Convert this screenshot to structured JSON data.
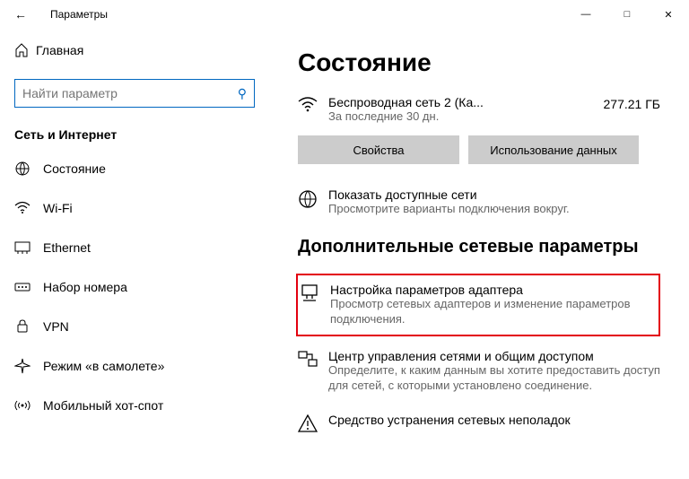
{
  "window": {
    "title": "Параметры"
  },
  "sidebar": {
    "home": "Главная",
    "search_placeholder": "Найти параметр",
    "group": "Сеть и Интернет",
    "items": [
      {
        "label": "Состояние"
      },
      {
        "label": "Wi-Fi"
      },
      {
        "label": "Ethernet"
      },
      {
        "label": "Набор номера"
      },
      {
        "label": "VPN"
      },
      {
        "label": "Режим «в самолете»"
      },
      {
        "label": "Мобильный хот-спот"
      }
    ]
  },
  "status": {
    "heading": "Состояние",
    "network_name": "Беспроводная сеть 2 (Ка...",
    "network_sub": "За последние 30 дн.",
    "data_amount": "277.21 ГБ",
    "btn_props": "Свойства",
    "btn_usage": "Использование данных",
    "show_title": "Показать доступные сети",
    "show_sub": "Просмотрите варианты подключения вокруг.",
    "adv_heading": "Дополнительные сетевые параметры",
    "adapter_title": "Настройка параметров адаптера",
    "adapter_sub": "Просмотр сетевых адаптеров и изменение параметров подключения.",
    "center_title": "Центр управления сетями и общим доступом",
    "center_sub": "Определите, к каким данным вы хотите предоставить доступ для сетей, с которыми установлено соединение.",
    "troubleshoot_title": "Средство устранения сетевых неполадок"
  }
}
